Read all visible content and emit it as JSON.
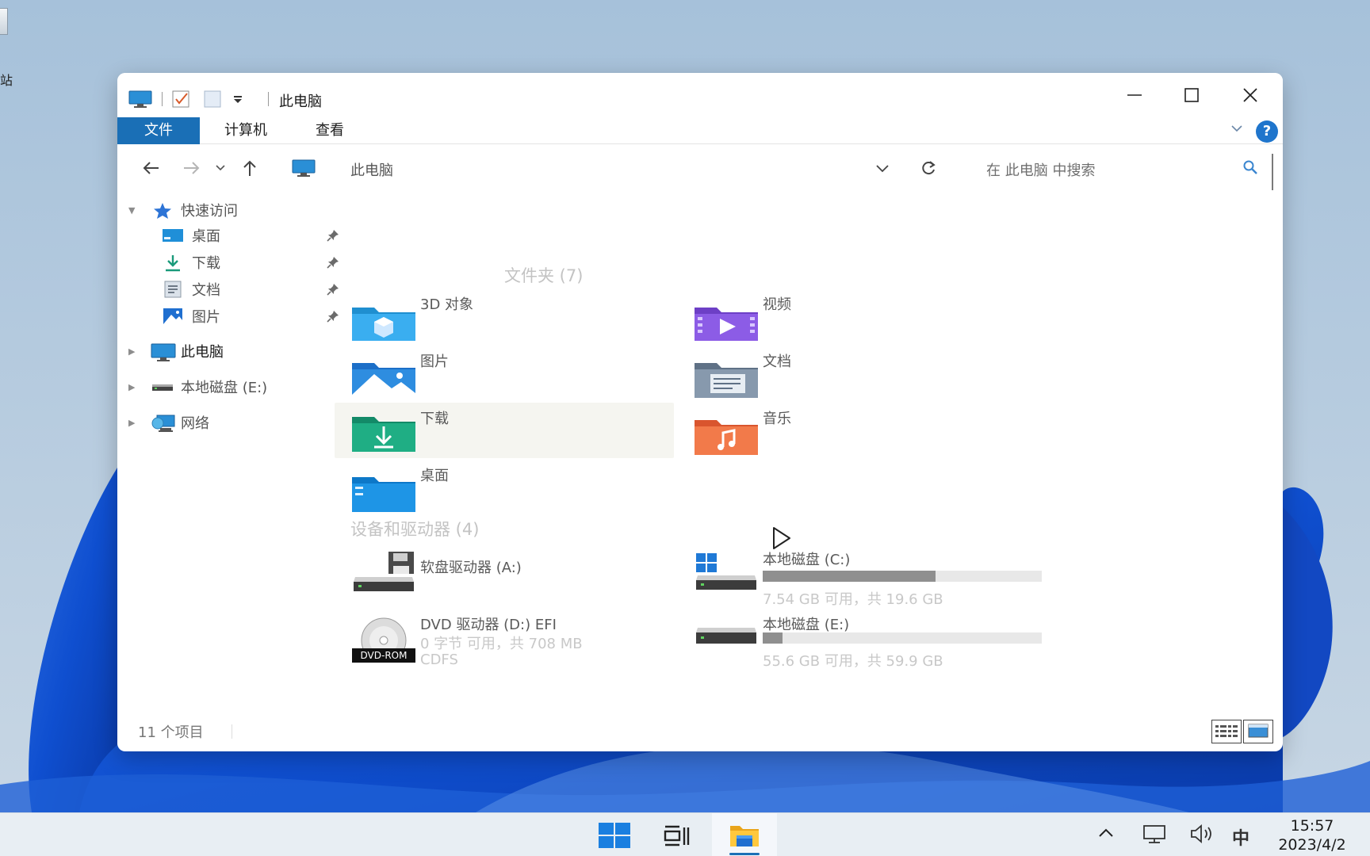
{
  "desktop": {
    "partial_label": "站"
  },
  "window": {
    "title": "此电脑",
    "controls": {
      "minimize": "—",
      "maximize": "☐",
      "close": "✕"
    }
  },
  "ribbon": {
    "tabs": [
      {
        "label": "文件",
        "active": true
      },
      {
        "label": "计算机"
      },
      {
        "label": "查看"
      }
    ],
    "help": "?"
  },
  "nav": {
    "address": "此电脑",
    "search_placeholder": "在 此电脑 中搜索"
  },
  "sidebar": {
    "quick_access": "快速访问",
    "pinned": [
      {
        "label": "桌面",
        "icon": "desktop-icon"
      },
      {
        "label": "下载",
        "icon": "download-icon"
      },
      {
        "label": "文档",
        "icon": "document-icon"
      },
      {
        "label": "图片",
        "icon": "picture-icon"
      }
    ],
    "this_pc": "此电脑",
    "local_disk_e": "本地磁盘 (E:)",
    "network": "网络"
  },
  "content": {
    "folders_header": "文件夹 (7)",
    "folders": [
      {
        "name": "3D 对象",
        "icon": "3d-objects-folder-icon"
      },
      {
        "name": "视频",
        "icon": "videos-folder-icon"
      },
      {
        "name": "图片",
        "icon": "pictures-folder-icon"
      },
      {
        "name": "文档",
        "icon": "documents-folder-icon"
      },
      {
        "name": "下载",
        "icon": "downloads-folder-icon",
        "selected": true
      },
      {
        "name": "音乐",
        "icon": "music-folder-icon"
      },
      {
        "name": "桌面",
        "icon": "desktop-folder-icon"
      }
    ],
    "devices_header": "设备和驱动器 (4)",
    "devices": [
      {
        "name": "软盘驱动器 (A:)",
        "icon": "floppy-drive-icon"
      },
      {
        "name": "本地磁盘 (C:)",
        "icon": "windows-drive-icon",
        "used_fraction": 0.62,
        "detail": "7.54 GB 可用，共 19.6 GB"
      },
      {
        "name": "DVD 驱动器 (D:) EFI",
        "icon": "dvd-drive-icon",
        "detail": "0 字节 可用，共 708 MB",
        "detail2": "CDFS",
        "badge": "DVD-ROM"
      },
      {
        "name": "本地磁盘 (E:)",
        "icon": "hard-drive-icon",
        "used_fraction": 0.07,
        "detail": "55.6 GB 可用，共 59.9 GB"
      }
    ]
  },
  "status": {
    "item_count": "11 个项目"
  },
  "taskbar": {
    "ime": "中",
    "time": "15:57",
    "date": "2023/4/2",
    "colors": {
      "accent": "#1a6fb6"
    }
  }
}
